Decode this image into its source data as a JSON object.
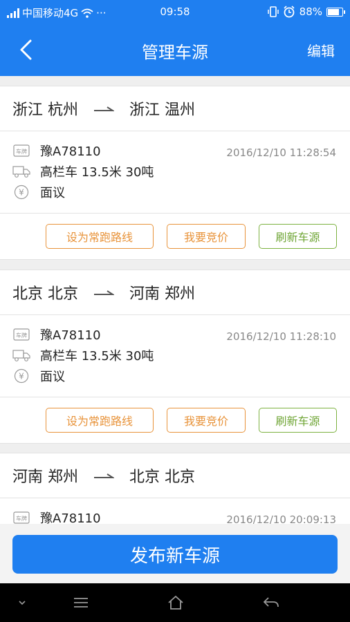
{
  "status_bar": {
    "carrier": "中国移动4G",
    "dots": "···",
    "time": "09:58",
    "battery": "88%",
    "battery_level": 0.88
  },
  "header": {
    "title": "管理车源",
    "edit_label": "编辑"
  },
  "cards": [
    {
      "from": "浙江 杭州",
      "to": "浙江 温州",
      "plate": "豫A78110",
      "vehicle": "高栏车  13.5米  30吨",
      "price": "面议",
      "time": "2016/12/10    11:28:54",
      "btn_route": "设为常跑路线",
      "btn_bid": "我要竞价",
      "btn_refresh": "刷新车源"
    },
    {
      "from": "北京 北京",
      "to": "河南 郑州",
      "plate": "豫A78110",
      "vehicle": "高栏车  13.5米  30吨",
      "price": "面议",
      "time": "2016/12/10    11:28:10",
      "btn_route": "设为常跑路线",
      "btn_bid": "我要竞价",
      "btn_refresh": "刷新车源"
    },
    {
      "from": "河南 郑州",
      "to": "北京 北京",
      "plate": "豫A78110",
      "time": "2016/12/10    20:09:13"
    }
  ],
  "publish_label": "发布新车源",
  "plate_icon_text": "车牌",
  "price_icon_text": "¥",
  "colors": {
    "primary": "#1f7ff0",
    "orange": "#e8933a",
    "green": "#7cb13f"
  }
}
